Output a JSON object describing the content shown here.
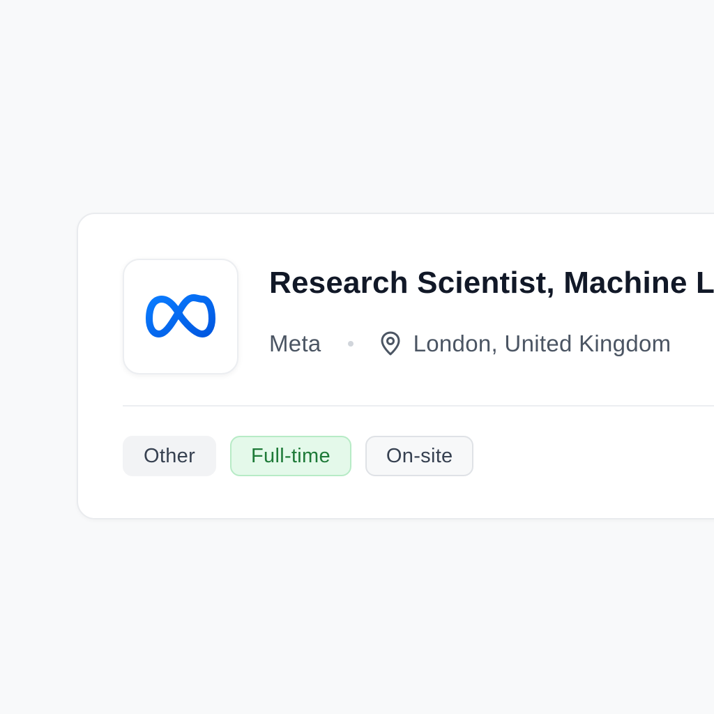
{
  "job": {
    "title": "Research Scientist, Machine L",
    "company": "Meta",
    "location": "London, United Kingdom",
    "logo_icon": "meta-infinity-logo",
    "location_icon": "map-pin-icon"
  },
  "tags": {
    "category": "Other",
    "employment_type": "Full-time",
    "workplace": "On-site"
  },
  "colors": {
    "brand_blue": "#0866FF",
    "fulltime_bg": "#e4f9ea",
    "fulltime_text": "#1e7a38"
  }
}
